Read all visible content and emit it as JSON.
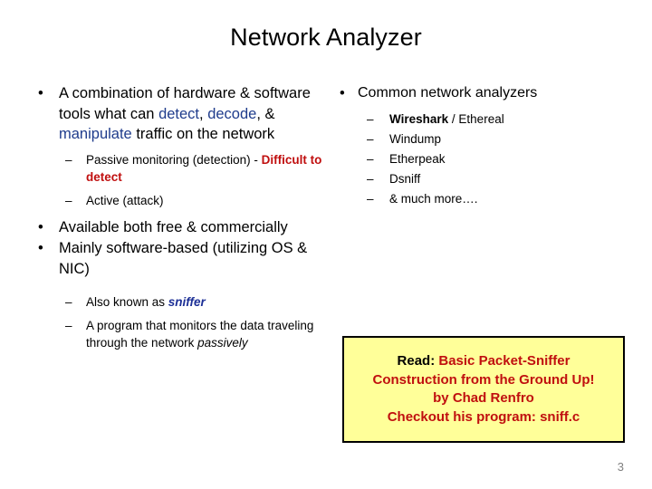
{
  "slide": {
    "title": "Network Analyzer",
    "page_number": "3",
    "colors": {
      "accent_blue": "#1f3c8c",
      "alert_red": "#c00f0f",
      "callout_bg": "#ffff99",
      "callout_border": "#000000",
      "page_number": "#808080"
    },
    "bullet_marker": "•",
    "dash_marker": "–"
  },
  "left_column": {
    "bullet_1": {
      "part_a": "A combination of hardware & software tools what can ",
      "kw_detect": "detect",
      "comma_1": ", ",
      "kw_decode": "decode",
      "mid": ", & ",
      "kw_manipulate": "manipulate",
      "part_b": " traffic on the network"
    },
    "sub_1": {
      "text": "Passive monitoring (detection) - ",
      "emphasis": "Difficult to detect"
    },
    "sub_2": {
      "text": "Active (attack)"
    },
    "bullet_2": "Available both free & commercially",
    "bullet_3": "Mainly software-based (utilizing OS & NIC)",
    "sub_3": {
      "text": "Also known as ",
      "emphasis": "sniffer"
    },
    "sub_4": {
      "text": "A program that monitors the data traveling through the network ",
      "emphasis": "passively"
    }
  },
  "right_column": {
    "bullet_1": "Common network analyzers",
    "analyzers": [
      {
        "name": "Wireshark",
        "suffix": " / Ethereal",
        "bold": true
      },
      {
        "name": "Windump",
        "suffix": "",
        "bold": false
      },
      {
        "name": "Etherpeak",
        "suffix": "",
        "bold": false
      },
      {
        "name": "Dsniff",
        "suffix": "",
        "bold": false
      },
      {
        "name": "& much more….",
        "suffix": "",
        "bold": false
      }
    ]
  },
  "callout": {
    "lead": "Read: ",
    "line_1": "Basic Packet-Sniffer",
    "line_2": "Construction from the Ground Up!",
    "line_3": "by Chad Renfro",
    "line_4": "Checkout his program: sniff.c"
  }
}
